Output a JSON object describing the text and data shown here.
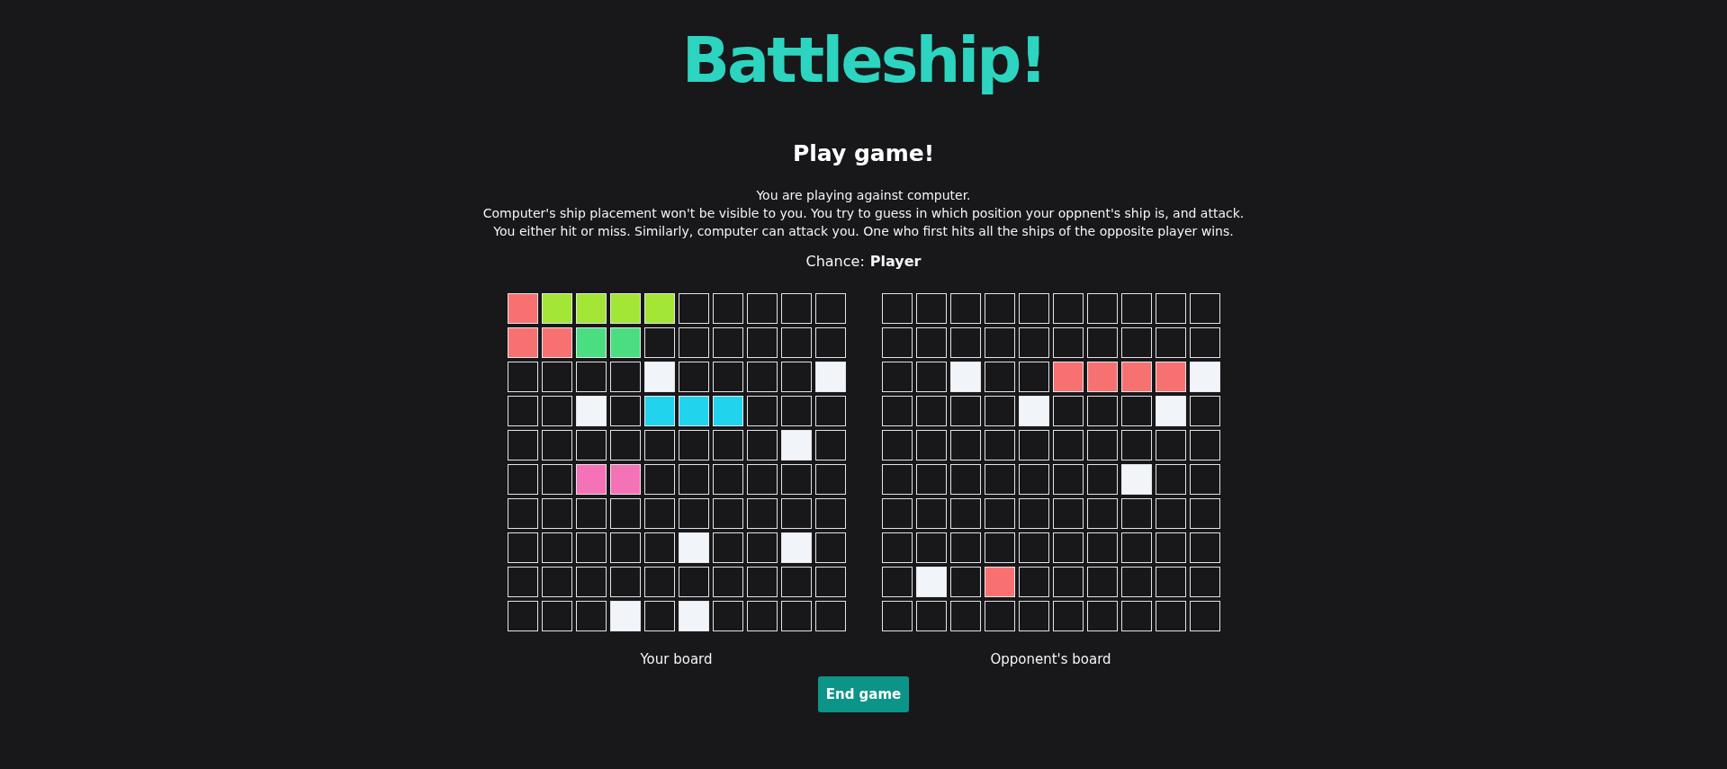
{
  "title": "Battleship!",
  "heading": "Play game!",
  "intro": [
    "You are playing against computer.",
    "Computer's ship placement won't be visible to you. You try to guess in which position your oppnent's ship is, and attack.",
    "You either hit or miss. Similarly, computer can attack you. One who first hits all the ships of the opposite player wins."
  ],
  "chance": {
    "label": "Chance:",
    "value": "Player"
  },
  "boards": [
    {
      "label": "Your board",
      "rows": [
        [
          {
            "kind": "hit"
          },
          {
            "kind": "ship",
            "color": "#a3e635"
          },
          {
            "kind": "ship",
            "color": "#a3e635"
          },
          {
            "kind": "ship",
            "color": "#a3e635"
          },
          {
            "kind": "ship",
            "color": "#a3e635"
          },
          {
            "kind": "empty"
          },
          {
            "kind": "empty"
          },
          {
            "kind": "empty"
          },
          {
            "kind": "empty"
          },
          {
            "kind": "empty"
          }
        ],
        [
          {
            "kind": "hit"
          },
          {
            "kind": "hit"
          },
          {
            "kind": "ship",
            "color": "#4ade80"
          },
          {
            "kind": "ship",
            "color": "#4ade80"
          },
          {
            "kind": "empty"
          },
          {
            "kind": "empty"
          },
          {
            "kind": "empty"
          },
          {
            "kind": "empty"
          },
          {
            "kind": "empty"
          },
          {
            "kind": "empty"
          }
        ],
        [
          {
            "kind": "empty"
          },
          {
            "kind": "empty"
          },
          {
            "kind": "empty"
          },
          {
            "kind": "empty"
          },
          {
            "kind": "miss"
          },
          {
            "kind": "empty"
          },
          {
            "kind": "empty"
          },
          {
            "kind": "empty"
          },
          {
            "kind": "empty"
          },
          {
            "kind": "miss"
          }
        ],
        [
          {
            "kind": "empty"
          },
          {
            "kind": "empty"
          },
          {
            "kind": "miss"
          },
          {
            "kind": "empty"
          },
          {
            "kind": "ship",
            "color": "#22d3ee"
          },
          {
            "kind": "ship",
            "color": "#22d3ee"
          },
          {
            "kind": "ship",
            "color": "#22d3ee"
          },
          {
            "kind": "empty"
          },
          {
            "kind": "empty"
          },
          {
            "kind": "empty"
          }
        ],
        [
          {
            "kind": "empty"
          },
          {
            "kind": "empty"
          },
          {
            "kind": "empty"
          },
          {
            "kind": "empty"
          },
          {
            "kind": "empty"
          },
          {
            "kind": "empty"
          },
          {
            "kind": "empty"
          },
          {
            "kind": "empty"
          },
          {
            "kind": "miss"
          },
          {
            "kind": "empty"
          }
        ],
        [
          {
            "kind": "empty"
          },
          {
            "kind": "empty"
          },
          {
            "kind": "ship",
            "color": "#f472b6"
          },
          {
            "kind": "ship",
            "color": "#f472b6"
          },
          {
            "kind": "empty"
          },
          {
            "kind": "empty"
          },
          {
            "kind": "empty"
          },
          {
            "kind": "empty"
          },
          {
            "kind": "empty"
          },
          {
            "kind": "empty"
          }
        ],
        [
          {
            "kind": "empty"
          },
          {
            "kind": "empty"
          },
          {
            "kind": "empty"
          },
          {
            "kind": "empty"
          },
          {
            "kind": "empty"
          },
          {
            "kind": "empty"
          },
          {
            "kind": "empty"
          },
          {
            "kind": "empty"
          },
          {
            "kind": "empty"
          },
          {
            "kind": "empty"
          }
        ],
        [
          {
            "kind": "empty"
          },
          {
            "kind": "empty"
          },
          {
            "kind": "empty"
          },
          {
            "kind": "empty"
          },
          {
            "kind": "empty"
          },
          {
            "kind": "miss"
          },
          {
            "kind": "empty"
          },
          {
            "kind": "empty"
          },
          {
            "kind": "miss"
          },
          {
            "kind": "empty"
          }
        ],
        [
          {
            "kind": "empty"
          },
          {
            "kind": "empty"
          },
          {
            "kind": "empty"
          },
          {
            "kind": "empty"
          },
          {
            "kind": "empty"
          },
          {
            "kind": "empty"
          },
          {
            "kind": "empty"
          },
          {
            "kind": "empty"
          },
          {
            "kind": "empty"
          },
          {
            "kind": "empty"
          }
        ],
        [
          {
            "kind": "empty"
          },
          {
            "kind": "empty"
          },
          {
            "kind": "empty"
          },
          {
            "kind": "miss"
          },
          {
            "kind": "empty"
          },
          {
            "kind": "miss"
          },
          {
            "kind": "empty"
          },
          {
            "kind": "empty"
          },
          {
            "kind": "empty"
          },
          {
            "kind": "empty"
          }
        ]
      ]
    },
    {
      "label": "Opponent's board",
      "rows": [
        [
          {
            "kind": "empty"
          },
          {
            "kind": "empty"
          },
          {
            "kind": "empty"
          },
          {
            "kind": "empty"
          },
          {
            "kind": "empty"
          },
          {
            "kind": "empty"
          },
          {
            "kind": "empty"
          },
          {
            "kind": "empty"
          },
          {
            "kind": "empty"
          },
          {
            "kind": "empty"
          }
        ],
        [
          {
            "kind": "empty"
          },
          {
            "kind": "empty"
          },
          {
            "kind": "empty"
          },
          {
            "kind": "empty"
          },
          {
            "kind": "empty"
          },
          {
            "kind": "empty"
          },
          {
            "kind": "empty"
          },
          {
            "kind": "empty"
          },
          {
            "kind": "empty"
          },
          {
            "kind": "empty"
          }
        ],
        [
          {
            "kind": "empty"
          },
          {
            "kind": "empty"
          },
          {
            "kind": "miss"
          },
          {
            "kind": "empty"
          },
          {
            "kind": "empty"
          },
          {
            "kind": "hit"
          },
          {
            "kind": "hit"
          },
          {
            "kind": "hit"
          },
          {
            "kind": "hit"
          },
          {
            "kind": "miss"
          }
        ],
        [
          {
            "kind": "empty"
          },
          {
            "kind": "empty"
          },
          {
            "kind": "empty"
          },
          {
            "kind": "empty"
          },
          {
            "kind": "miss"
          },
          {
            "kind": "empty"
          },
          {
            "kind": "empty"
          },
          {
            "kind": "empty"
          },
          {
            "kind": "miss"
          },
          {
            "kind": "empty"
          }
        ],
        [
          {
            "kind": "empty"
          },
          {
            "kind": "empty"
          },
          {
            "kind": "empty"
          },
          {
            "kind": "empty"
          },
          {
            "kind": "empty"
          },
          {
            "kind": "empty"
          },
          {
            "kind": "empty"
          },
          {
            "kind": "empty"
          },
          {
            "kind": "empty"
          },
          {
            "kind": "empty"
          }
        ],
        [
          {
            "kind": "empty"
          },
          {
            "kind": "empty"
          },
          {
            "kind": "empty"
          },
          {
            "kind": "empty"
          },
          {
            "kind": "empty"
          },
          {
            "kind": "empty"
          },
          {
            "kind": "empty"
          },
          {
            "kind": "miss"
          },
          {
            "kind": "empty"
          },
          {
            "kind": "empty"
          }
        ],
        [
          {
            "kind": "empty"
          },
          {
            "kind": "empty"
          },
          {
            "kind": "empty"
          },
          {
            "kind": "empty"
          },
          {
            "kind": "empty"
          },
          {
            "kind": "empty"
          },
          {
            "kind": "empty"
          },
          {
            "kind": "empty"
          },
          {
            "kind": "empty"
          },
          {
            "kind": "empty"
          }
        ],
        [
          {
            "kind": "empty"
          },
          {
            "kind": "empty"
          },
          {
            "kind": "empty"
          },
          {
            "kind": "empty"
          },
          {
            "kind": "empty"
          },
          {
            "kind": "empty"
          },
          {
            "kind": "empty"
          },
          {
            "kind": "empty"
          },
          {
            "kind": "empty"
          },
          {
            "kind": "empty"
          }
        ],
        [
          {
            "kind": "empty"
          },
          {
            "kind": "miss"
          },
          {
            "kind": "empty"
          },
          {
            "kind": "hit"
          },
          {
            "kind": "empty"
          },
          {
            "kind": "empty"
          },
          {
            "kind": "empty"
          },
          {
            "kind": "empty"
          },
          {
            "kind": "empty"
          },
          {
            "kind": "empty"
          }
        ],
        [
          {
            "kind": "empty"
          },
          {
            "kind": "empty"
          },
          {
            "kind": "empty"
          },
          {
            "kind": "empty"
          },
          {
            "kind": "empty"
          },
          {
            "kind": "empty"
          },
          {
            "kind": "empty"
          },
          {
            "kind": "empty"
          },
          {
            "kind": "empty"
          },
          {
            "kind": "empty"
          }
        ]
      ]
    }
  ],
  "button": "End game"
}
